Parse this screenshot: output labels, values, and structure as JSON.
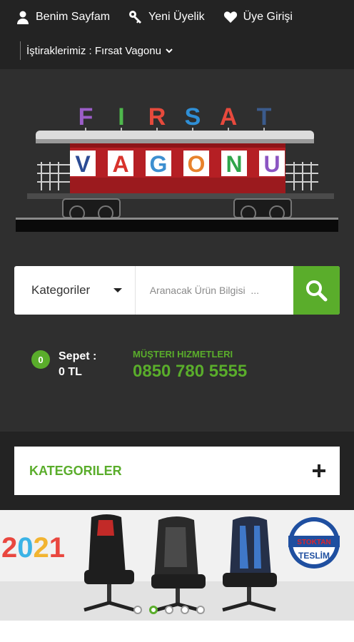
{
  "topbar": {
    "links": [
      {
        "label": "Benim Sayfam",
        "icon": "user-icon"
      },
      {
        "label": "Yeni Üyelik",
        "icon": "key-icon"
      },
      {
        "label": "Üye Girişi",
        "icon": "heart-icon"
      }
    ],
    "affiliate": "İştiraklerimiz : Fırsat Vagonu"
  },
  "logo": {
    "top_letters": [
      "F",
      "I",
      "R",
      "S",
      "A",
      "T"
    ],
    "car_letters": [
      "V",
      "A",
      "G",
      "O",
      "N",
      "U"
    ]
  },
  "search": {
    "category_label": "Kategoriler",
    "placeholder": "Aranacak Ürün Bilgisi  ..."
  },
  "cart": {
    "count": "0",
    "label": "Sepet :",
    "total": "0 TL"
  },
  "service": {
    "label": "MÜŞTERI HIZMETLERI",
    "phone": "0850 780 5555"
  },
  "categories": {
    "title": "KATEGORILER"
  },
  "banner": {
    "year": "2021",
    "stamp_top": "STOKTAN",
    "stamp_bottom": "TESLİM",
    "dots": 5,
    "active_dot": 2
  },
  "colors": {
    "accent": "#5aad2b",
    "topbar_bg": "#232323",
    "header_bg": "#2f2f2f"
  }
}
